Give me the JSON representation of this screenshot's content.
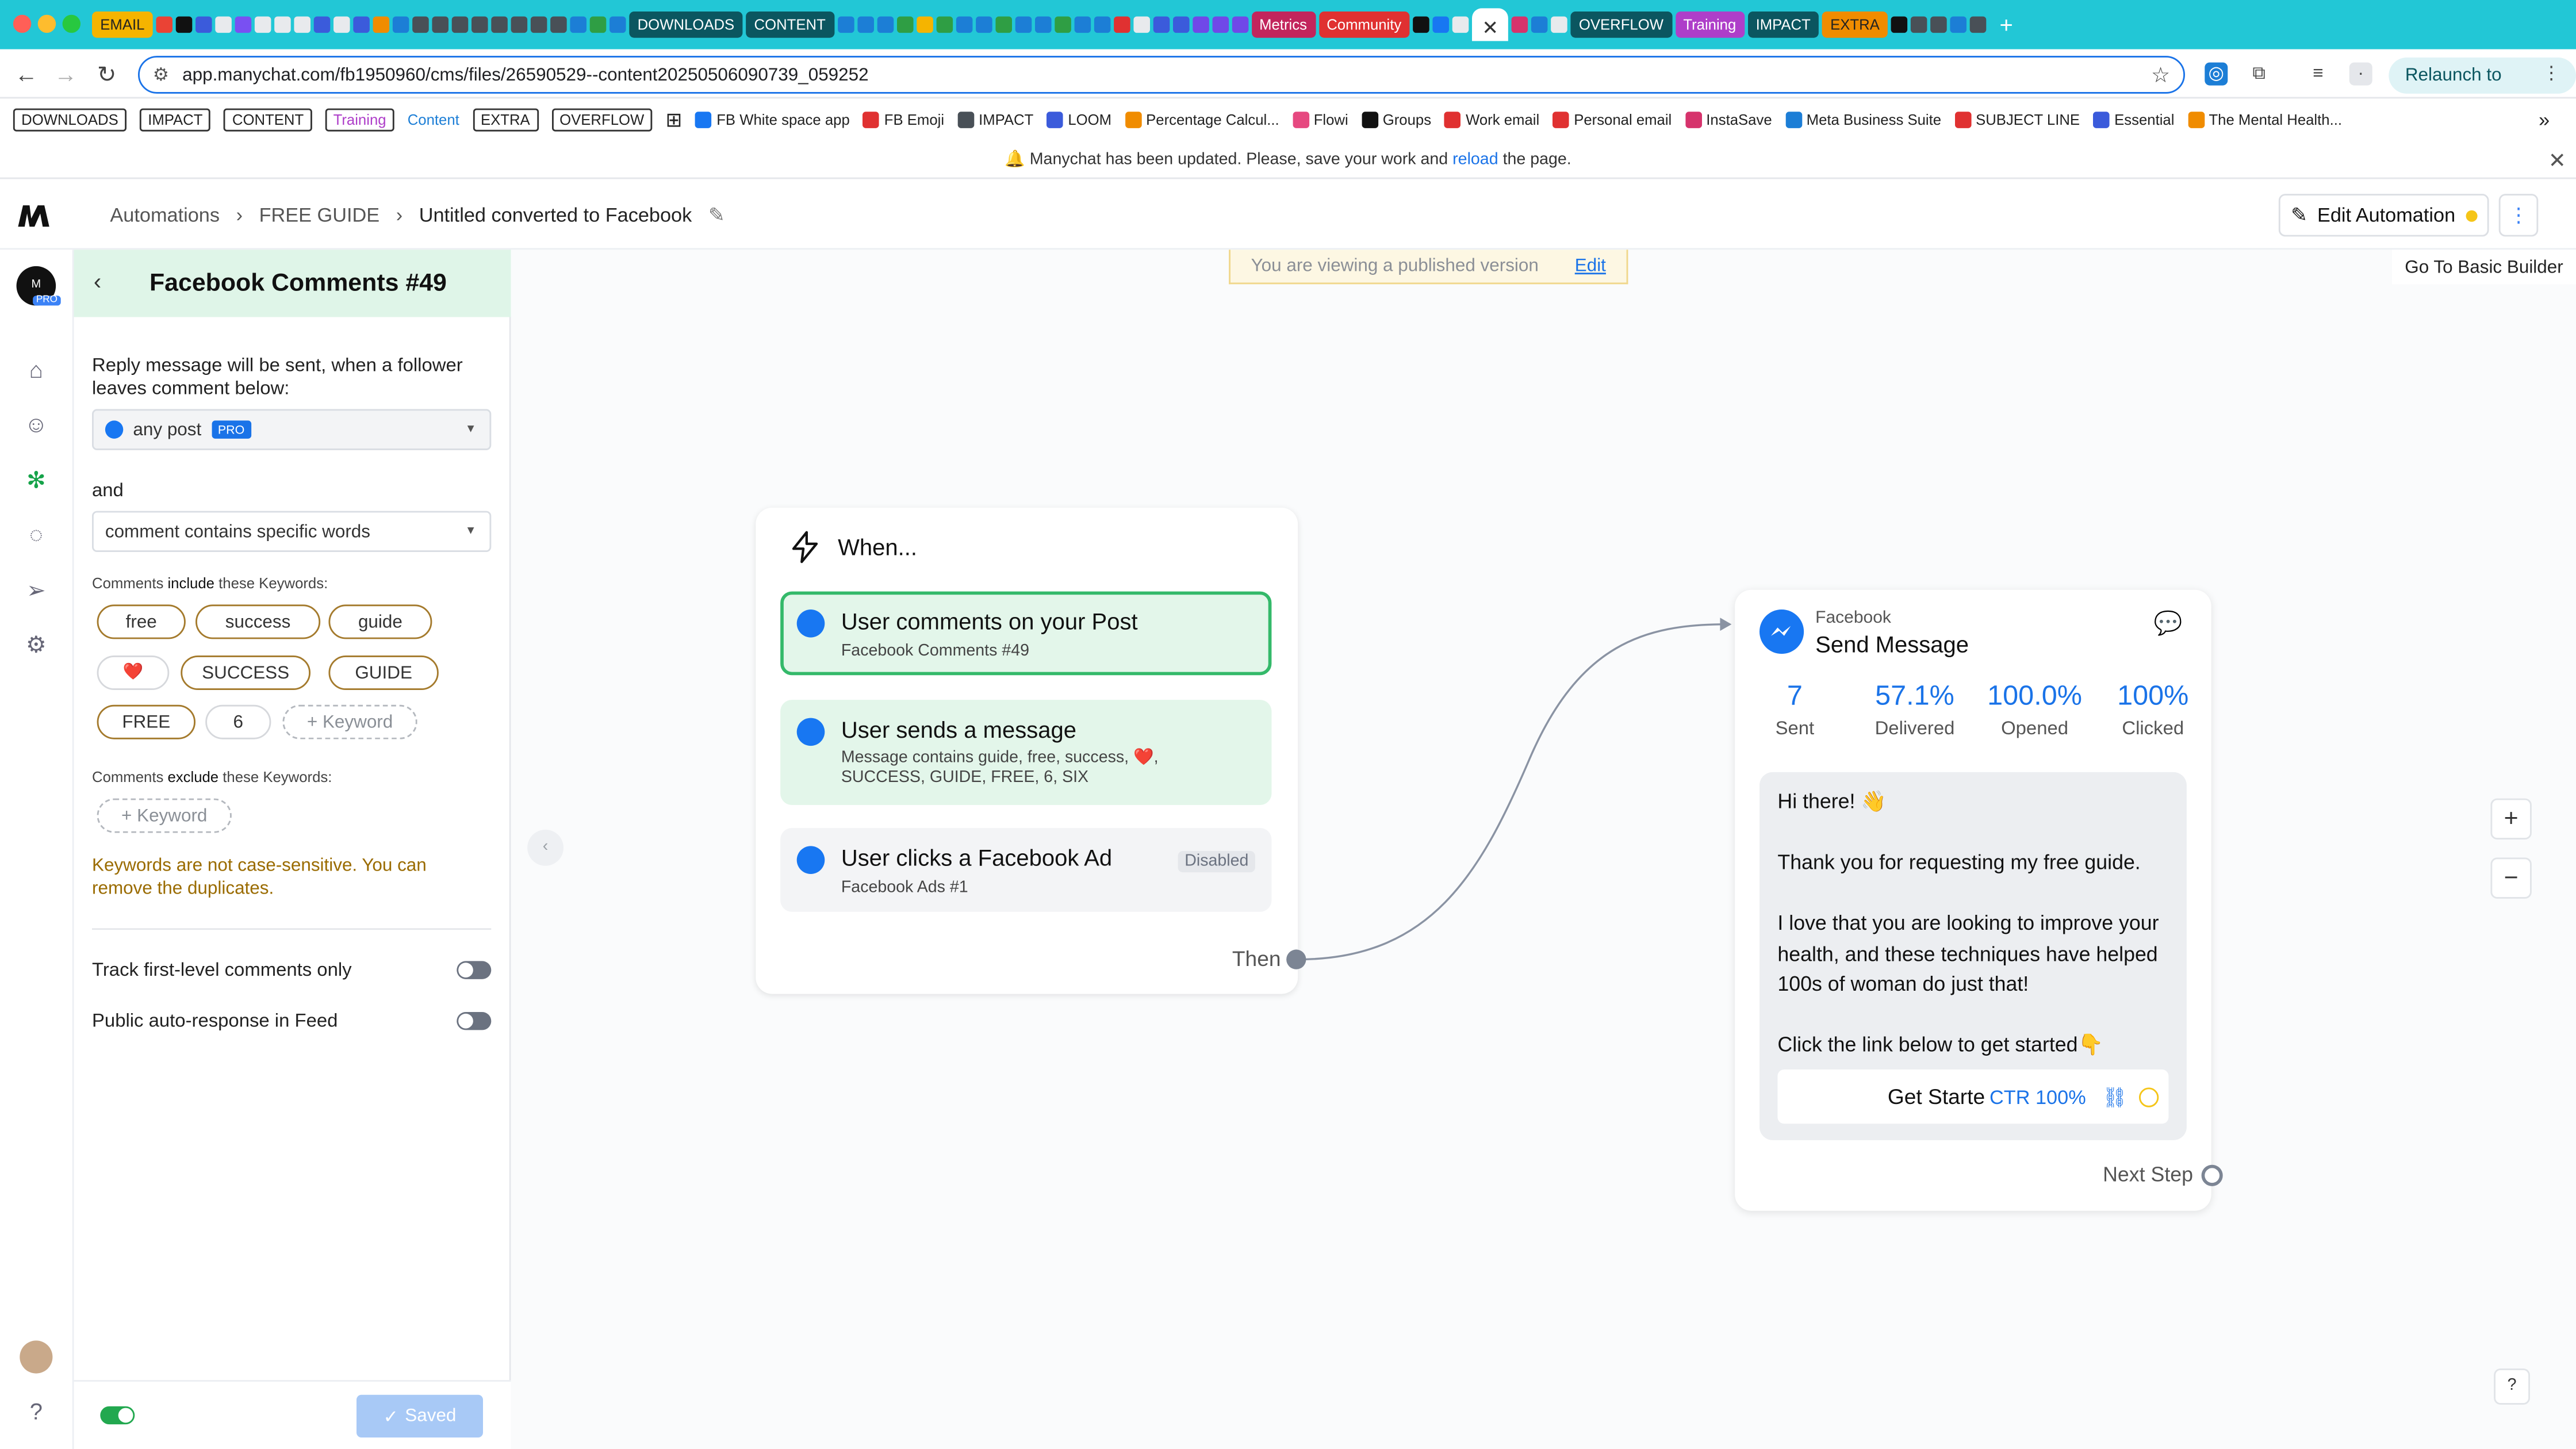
{
  "browser": {
    "tabs_group_labels": [
      "EMAIL",
      "DOWNLOADS",
      "CONTENT",
      "Metrics",
      "Community",
      "OVERFLOW",
      "Training",
      "IMPACT",
      "EXTRA"
    ],
    "url": "app.manychat.com/fb1950960/cms/files/26590529--content20250506090739_059252",
    "relaunch_label": "Relaunch to update"
  },
  "bookmarks": {
    "boxed": [
      "DOWNLOADS",
      "IMPACT",
      "CONTENT",
      "Training",
      "Content",
      "EXTRA",
      "OVERFLOW"
    ],
    "links": [
      "FB White space app",
      "FB Emoji",
      "IMPACT",
      "LOOM",
      "Percentage Calcul...",
      "Flowi",
      "Groups",
      "Work email",
      "Personal email",
      "InstaSave",
      "Meta Business Suite",
      "SUBJECT LINE",
      "Essential",
      "The Mental Health..."
    ]
  },
  "notice": {
    "text_before": "Manychat has been updated. Please, save your work and ",
    "link": "reload",
    "text_after": " the page."
  },
  "header": {
    "breadcrumb": [
      "Automations",
      "FREE GUIDE",
      "Untitled converted to Facebook"
    ],
    "edit_automation": "Edit Automation"
  },
  "rail": {
    "avatar_label": "M",
    "pro_badge": "PRO"
  },
  "panel": {
    "title": "Facebook Comments #49",
    "intro": "Reply message will be sent, when a follower leaves comment below:",
    "post_select": "any post",
    "pro_tag": "PRO",
    "and_label": "and",
    "condition_select": "comment contains specific words",
    "include_label_a": "Comments ",
    "include_label_b": "include",
    "include_label_c": " these Keywords:",
    "keywords": [
      "free",
      "success",
      "guide",
      "❤️",
      "SUCCESS",
      "GUIDE",
      "FREE",
      "6"
    ],
    "add_keyword": "+ Keyword",
    "exclude_label_a": "Comments ",
    "exclude_label_b": "exclude",
    "exclude_label_c": " these Keywords:",
    "case_note": "Keywords are not case-sensitive. You can remove the duplicates.",
    "toggles": [
      {
        "label": "Track first-level comments only",
        "on": false
      },
      {
        "label": "Public auto-response in Feed",
        "on": false
      }
    ],
    "saved_label": "Saved"
  },
  "canvas": {
    "published_banner": "You are viewing a published version",
    "published_edit": "Edit",
    "basic_builder": "Go To Basic Builder",
    "when_title": "When...",
    "triggers": [
      {
        "title": "User comments on your Post",
        "sub": "Facebook Comments #49"
      },
      {
        "title": "User sends a message",
        "sub": "Message contains guide, free, success, ❤️, SUCCESS, GUIDE, FREE, 6, SIX"
      },
      {
        "title": "User clicks a Facebook Ad",
        "sub": "Facebook Ads #1",
        "tag": "Disabled"
      }
    ],
    "then_label": "Then",
    "send": {
      "channel": "Facebook",
      "title": "Send Message",
      "stats": [
        {
          "value": "7",
          "label": "Sent"
        },
        {
          "value": "57.1%",
          "label": "Delivered"
        },
        {
          "value": "100.0%",
          "label": "Opened"
        },
        {
          "value": "100%",
          "label": "Clicked"
        }
      ],
      "greeting": "Hi there! 👋",
      "line1": "Thank you for requesting my free guide.",
      "line2": "I love that you are looking to improve your health, and these techniques have helped 100s of woman do just that!",
      "line3": "Click the link below to get started👇",
      "button_label": "Get Starte",
      "ctr": "CTR 100%",
      "next_step": "Next Step"
    }
  }
}
